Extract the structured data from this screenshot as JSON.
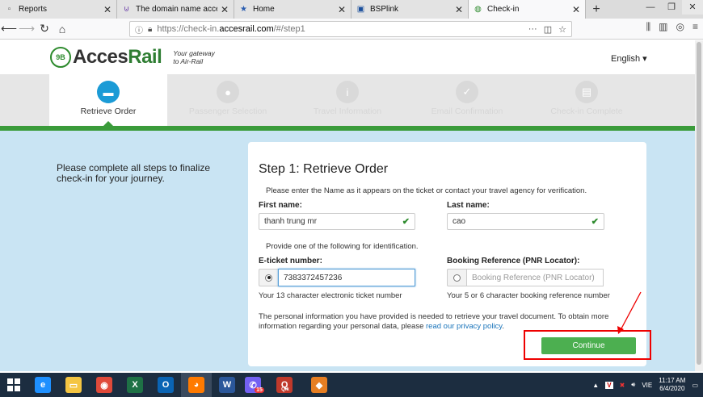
{
  "browser": {
    "tabs": [
      {
        "title": "Reports",
        "icon": "page-icon",
        "active": false,
        "width": 143
      },
      {
        "title": "The domain name accessrail.co",
        "icon": "shield-icon",
        "active": false,
        "width": 143
      },
      {
        "title": "Home",
        "icon": "star-icon",
        "active": false,
        "width": 143
      },
      {
        "title": "BSPlink",
        "icon": "bsp-icon",
        "active": false,
        "width": 143
      },
      {
        "title": "Check-in",
        "icon": "globe-icon",
        "active": true,
        "width": 143
      }
    ],
    "new_tab_label": "+",
    "url_prefix": "https://check-in.",
    "url_host": "accesrail.com",
    "url_path": "/#/step1",
    "url_dots": "···"
  },
  "site": {
    "logo_badge": "9B",
    "logo_text_a": "Acces",
    "logo_text_b": "Rail",
    "tagline_line1": "Your gateway",
    "tagline_line2": "to Air-Rail",
    "language": "English ▾"
  },
  "steps": [
    {
      "label": "Retrieve Order",
      "active": true,
      "icon": "ticket-icon",
      "glyph": "▬"
    },
    {
      "label": "Passenger Selection",
      "active": false,
      "icon": "person-icon",
      "glyph": "●"
    },
    {
      "label": "Travel Information",
      "active": false,
      "icon": "info-icon",
      "glyph": "i"
    },
    {
      "label": "Email Confirmation",
      "active": false,
      "icon": "check-icon",
      "glyph": "✓"
    },
    {
      "label": "Check-in Complete",
      "active": false,
      "icon": "document-icon",
      "glyph": "▤"
    }
  ],
  "intro": "Please complete all steps to finalize check-in for your journey.",
  "form": {
    "title": "Step 1: Retrieve Order",
    "instruction": "Please enter the Name as it appears on the ticket or contact your travel agency for verification.",
    "first_name_label": "First name:",
    "first_name_value": "thanh trung mr",
    "last_name_label": "Last name:",
    "last_name_value": "cao",
    "identification_note": "Provide one of the following for identification.",
    "eticket_label": "E-ticket number:",
    "eticket_value": "7383372457236",
    "eticket_hint": "Your 13 character electronic ticket number",
    "pnr_label": "Booking Reference (PNR Locator):",
    "pnr_placeholder": "Booking Reference (PNR Locator)",
    "pnr_hint": "Your 5 or 6 character booking reference number",
    "notice_text": "The personal information you have provided is needed to retrieve your travel document. To obtain more information regarding your personal data, please ",
    "privacy_link": "read our privacy policy",
    "notice_end": ".",
    "continue_label": "Continue"
  },
  "taskbar": {
    "apps": [
      {
        "name": "ie-icon",
        "glyph": "e",
        "color": "#1e90ff"
      },
      {
        "name": "file-explorer-icon",
        "glyph": "▭",
        "color": "#f4c542"
      },
      {
        "name": "chrome-icon",
        "glyph": "◉",
        "color": "#e04a3a"
      },
      {
        "name": "excel-icon",
        "glyph": "X",
        "color": "#1e7145"
      },
      {
        "name": "outlook-icon",
        "glyph": "O",
        "color": "#0a64b4"
      },
      {
        "name": "firefox-icon",
        "glyph": "◕",
        "color": "#ff7a00"
      },
      {
        "name": "word-icon",
        "glyph": "W",
        "color": "#2b579a"
      },
      {
        "name": "viber-icon",
        "glyph": "✆",
        "color": "#7360f2"
      },
      {
        "name": "qik-icon",
        "glyph": "Q",
        "color": "#c0392b"
      },
      {
        "name": "app-icon",
        "glyph": "◆",
        "color": "#e67e22"
      }
    ],
    "viber_badge": "15",
    "qik_label": "Qik",
    "lang": "VIE",
    "time": "11:17 AM",
    "date": "6/4/2020"
  }
}
